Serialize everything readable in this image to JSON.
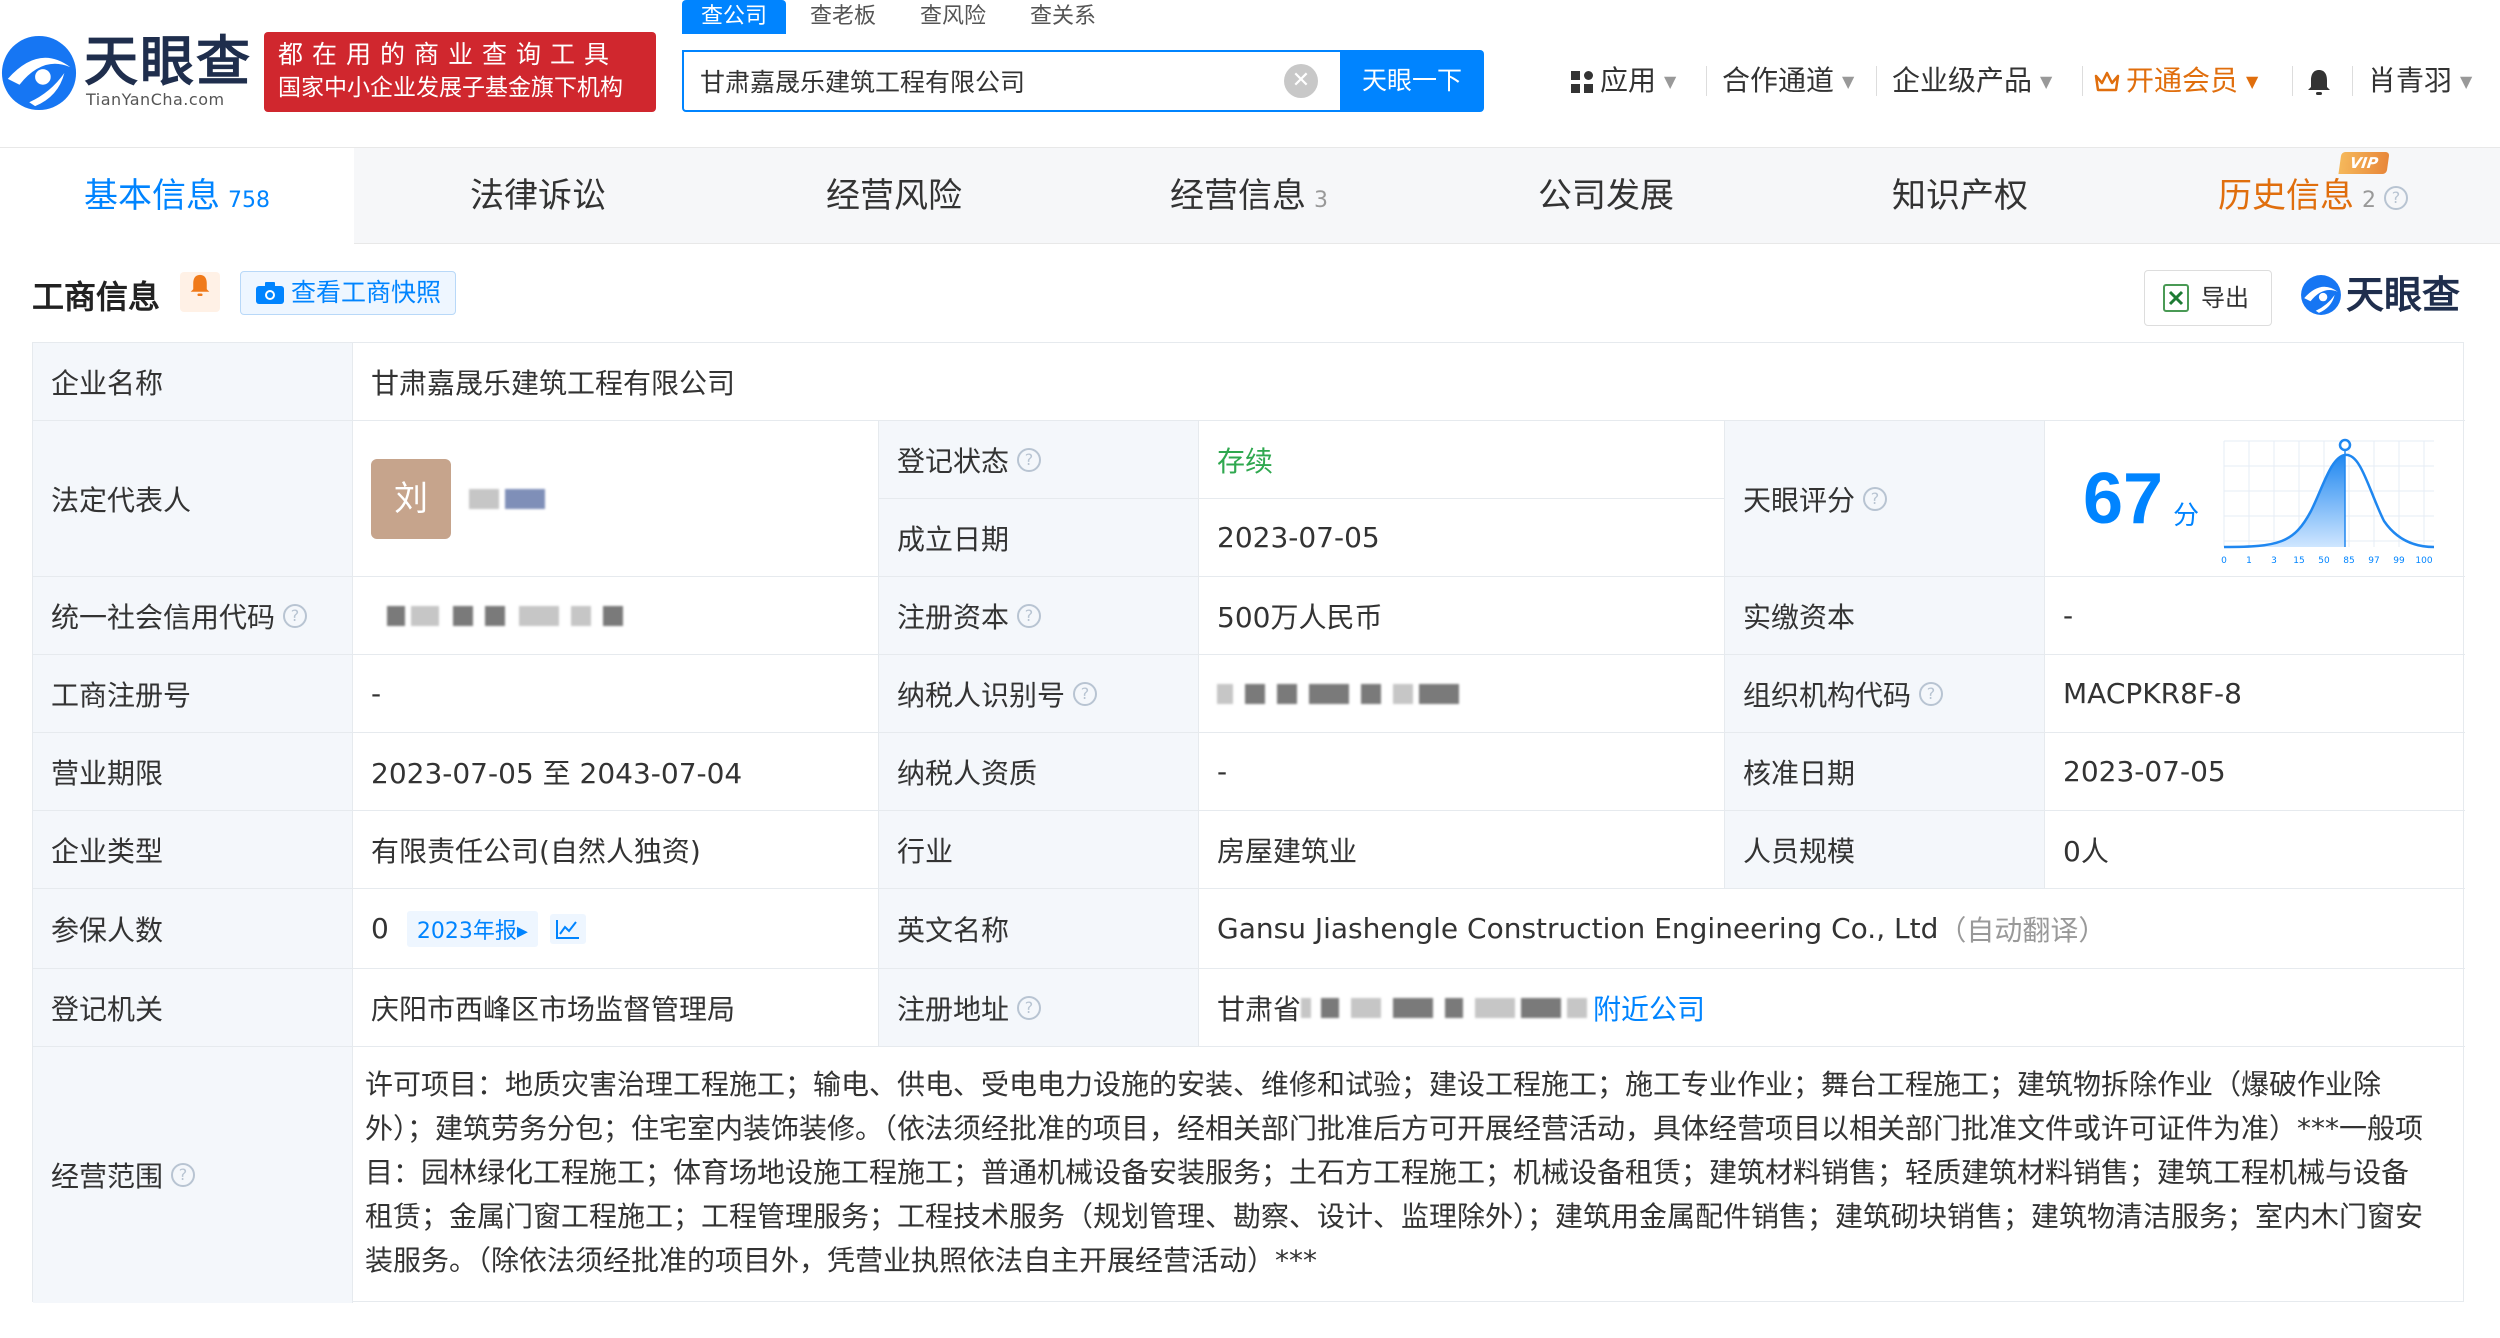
{
  "header": {
    "logo_cn": "天眼查",
    "logo_en": "TianYanCha.com",
    "slogan_line1": "都在用的商业查询工具",
    "slogan_line2": "国家中小企业发展子基金旗下机构",
    "search_tabs": [
      "查公司",
      "查老板",
      "查风险",
      "查关系"
    ],
    "search_value": "甘肃嘉晟乐建筑工程有限公司",
    "search_button": "天眼一下",
    "nav": {
      "apps": "应用",
      "partner": "合作通道",
      "enterprise": "企业级产品",
      "vip": "开通会员",
      "user": "肖青羽"
    }
  },
  "tabs": [
    {
      "label": "基本信息",
      "count": "758"
    },
    {
      "label": "法律诉讼",
      "count": ""
    },
    {
      "label": "经营风险",
      "count": ""
    },
    {
      "label": "经营信息",
      "count": "3"
    },
    {
      "label": "公司发展",
      "count": ""
    },
    {
      "label": "知识产权",
      "count": ""
    },
    {
      "label": "历史信息",
      "count": "2"
    }
  ],
  "vip_badge": "VIP",
  "section": {
    "title": "工商信息",
    "snapshot_button": "查看工商快照",
    "export_button": "导出",
    "watermark_logo": "天眼查"
  },
  "info": {
    "company_name_label": "企业名称",
    "company_name": "甘肃嘉晟乐建筑工程有限公司",
    "legal_rep_label": "法定代表人",
    "legal_rep_avatar": "刘",
    "reg_status_label": "登记状态",
    "reg_status": "存续",
    "found_date_label": "成立日期",
    "found_date": "2023-07-05",
    "score_label": "天眼评分",
    "score": "67",
    "score_unit": "分",
    "score_axis": [
      "0",
      "1",
      "3",
      "15",
      "50",
      "85",
      "97",
      "99",
      "100"
    ],
    "credit_code_label": "统一社会信用代码",
    "reg_capital_label": "注册资本",
    "reg_capital": "500万人民币",
    "paid_capital_label": "实缴资本",
    "paid_capital": "-",
    "biz_reg_no_label": "工商注册号",
    "biz_reg_no": "-",
    "tax_id_label": "纳税人识别号",
    "org_code_label": "组织机构代码",
    "org_code": "MACPKR8F-8",
    "term_label": "营业期限",
    "term": "2023-07-05 至 2043-07-04",
    "tax_qual_label": "纳税人资质",
    "tax_qual": "-",
    "approve_date_label": "核准日期",
    "approve_date": "2023-07-05",
    "type_label": "企业类型",
    "type": "有限责任公司(自然人独资)",
    "industry_label": "行业",
    "industry": "房屋建筑业",
    "staff_label": "人员规模",
    "staff": "0人",
    "insured_label": "参保人数",
    "insured": "0",
    "insured_report": "2023年报",
    "english_name_label": "英文名称",
    "english_name": "Gansu Jiashengle Construction Engineering Co., Ltd",
    "english_name_note": "（自动翻译）",
    "authority_label": "登记机关",
    "authority": "庆阳市西峰区市场监督管理局",
    "address_label": "注册地址",
    "address_prefix": "甘肃省",
    "nearby_link": "附近公司",
    "scope_label": "经营范围",
    "scope": "许可项目：地质灾害治理工程施工；输电、供电、受电电力设施的安装、维修和试验；建设工程施工；施工专业作业；舞台工程施工；建筑物拆除作业（爆破作业除外）；建筑劳务分包；住宅室内装饰装修。（依法须经批准的项目，经相关部门批准后方可开展经营活动，具体经营项目以相关部门批准文件或许可证件为准）***一般项目：园林绿化工程施工；体育场地设施工程施工；普通机械设备安装服务；土石方工程施工；机械设备租赁；建筑材料销售；轻质建筑材料销售；建筑工程机械与设备租赁；金属门窗工程施工；工程管理服务；工程技术服务（规划管理、勘察、设计、监理除外）；建筑用金属配件销售；建筑砌块销售；建筑物清洁服务；室内木门窗安装服务。（除依法须经批准的项目外，凭营业执照依法自主开展经营活动）***"
  },
  "colors": {
    "primary": "#0084ff",
    "brand_red": "#d0272e",
    "vip_orange": "#e06e0d",
    "status_green": "#2fa84f"
  },
  "icons": [
    "search-clear-icon",
    "apps-grid-icon",
    "crown-icon",
    "bell-icon",
    "camera-icon",
    "excel-icon",
    "question-icon",
    "trend-chart-icon"
  ]
}
